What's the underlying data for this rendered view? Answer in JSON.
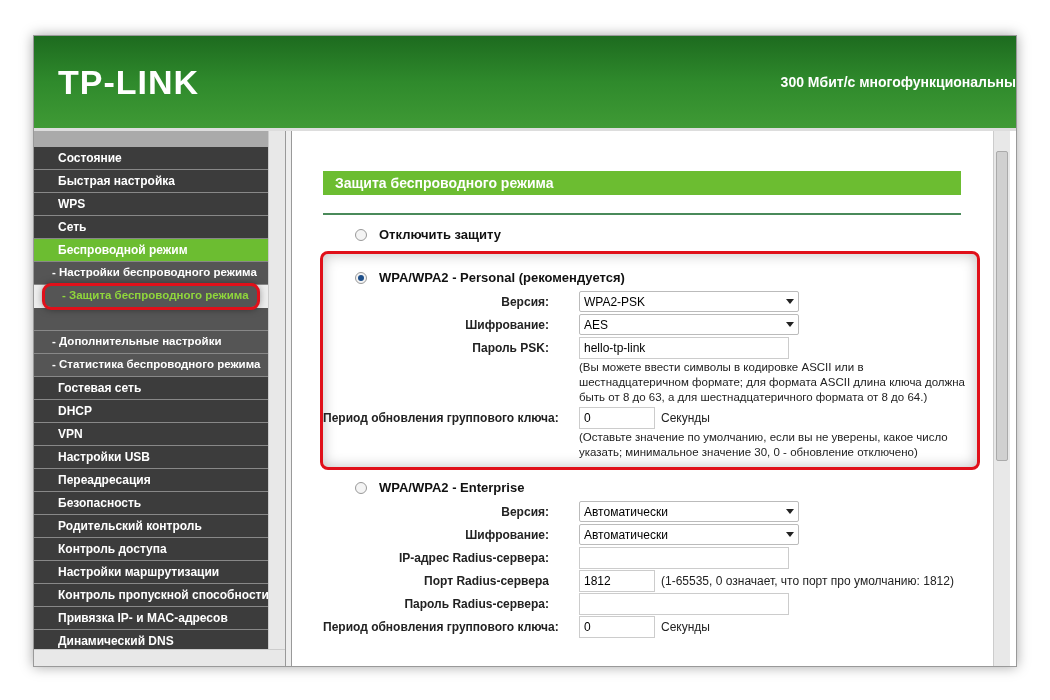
{
  "header": {
    "logo": "TP-LINK",
    "tagline": "300 Мбит/с многофункциональны"
  },
  "sidebar": {
    "items": [
      {
        "label": "Состояние",
        "kind": "main",
        "selected": false,
        "highlighted": false
      },
      {
        "label": "Быстрая настройка",
        "kind": "main",
        "selected": false,
        "highlighted": false
      },
      {
        "label": "WPS",
        "kind": "main",
        "selected": false,
        "highlighted": false
      },
      {
        "label": "Сеть",
        "kind": "main",
        "selected": false,
        "highlighted": false
      },
      {
        "label": "Беспроводной режим",
        "kind": "main",
        "selected": true,
        "highlighted": false
      },
      {
        "label": "- Настройки беспроводного режима",
        "kind": "sub",
        "selected": false,
        "highlighted": false
      },
      {
        "label": "- Защита беспроводного режима",
        "kind": "sub",
        "selected": true,
        "highlighted": true
      },
      {
        "kind": "sub"
      },
      {
        "label": "- Дополнительные настройки",
        "kind": "sub",
        "selected": false,
        "highlighted": false
      },
      {
        "label": "- Статистика беспроводного режима",
        "kind": "sub",
        "selected": false,
        "highlighted": false
      },
      {
        "label": "Гостевая сеть",
        "kind": "main",
        "selected": false,
        "highlighted": false
      },
      {
        "label": "DHCP",
        "kind": "main",
        "selected": false,
        "highlighted": false
      },
      {
        "label": "VPN",
        "kind": "main",
        "selected": false,
        "highlighted": false
      },
      {
        "label": "Настройки USB",
        "kind": "main",
        "selected": false,
        "highlighted": false
      },
      {
        "label": "Переадресация",
        "kind": "main",
        "selected": false,
        "highlighted": false
      },
      {
        "label": "Безопасность",
        "kind": "main",
        "selected": false,
        "highlighted": false
      },
      {
        "label": "Родительский контроль",
        "kind": "main",
        "selected": false,
        "highlighted": false
      },
      {
        "label": "Контроль доступа",
        "kind": "main",
        "selected": false,
        "highlighted": false
      },
      {
        "label": "Настройки маршрутизации",
        "kind": "main",
        "selected": false,
        "highlighted": false
      },
      {
        "label": "Контроль пропускной способности",
        "kind": "main",
        "selected": false,
        "highlighted": false
      },
      {
        "label": "Привязка IP- и MAC-адресов",
        "kind": "main",
        "selected": false,
        "highlighted": false
      },
      {
        "label": "Динамический DNS",
        "kind": "main",
        "selected": false,
        "highlighted": false
      }
    ]
  },
  "main": {
    "title": "Защита беспроводного режима",
    "options": [
      {
        "label": "Отключить защиту",
        "selected": false,
        "highlighted": false
      },
      {
        "label": "WPA/WPA2 - Personal (рекомендуется)",
        "selected": true,
        "highlighted": true,
        "fields": [
          {
            "label": "Версия:",
            "kind": "select",
            "value": "WPA2-PSK"
          },
          {
            "label": "Шифрование:",
            "kind": "select",
            "value": "AES"
          },
          {
            "label": "Пароль PSK:",
            "kind": "text",
            "value": "hello-tp-link",
            "note": "(Вы можете ввести символы в кодировке ASCII или в шестнадцатеричном формате; для формата ASCII длина ключа должна быть от 8 до 63, а для шестнадцатеричного формата от 8 до 64.)"
          },
          {
            "label": "Период обновления группового ключа:",
            "kind": "short",
            "value": "0",
            "unit": "Секунды",
            "note": "(Оставьте значение по умолчанию, если вы не уверены, какое число указать; минимальное значение 30, 0 - обновление отключено)"
          }
        ]
      },
      {
        "label": "WPA/WPA2 - Enterprise",
        "selected": false,
        "highlighted": false,
        "fields": [
          {
            "label": "Версия:",
            "kind": "select",
            "value": "Автоматически"
          },
          {
            "label": "Шифрование:",
            "kind": "select",
            "value": "Автоматически"
          },
          {
            "label": "IP-адрес Radius-сервера:",
            "kind": "text"
          },
          {
            "label": "Порт Radius-сервера",
            "kind": "short",
            "value": "1812",
            "unit": "(1-65535, 0 означает, что порт про умолчанию: 1812)"
          },
          {
            "label": "Пароль Radius-сервера:",
            "kind": "text"
          },
          {
            "label": "Период обновления группового ключа:",
            "kind": "short",
            "value": "0",
            "unit": "Секунды"
          }
        ]
      }
    ]
  }
}
